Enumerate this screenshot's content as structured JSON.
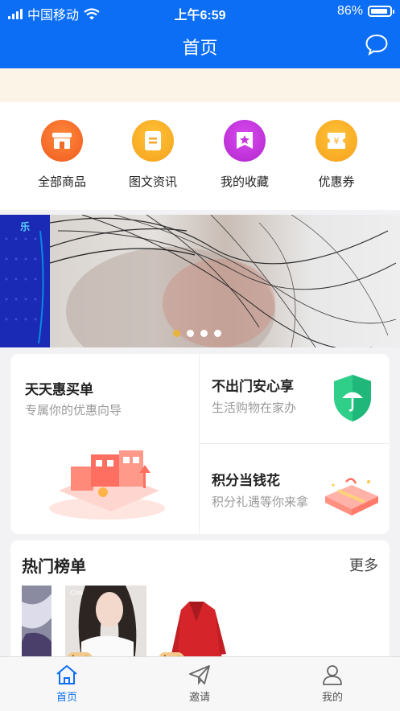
{
  "status_bar": {
    "carrier": "中国移动",
    "time": "上午6:59",
    "battery": "86%"
  },
  "nav": {
    "title": "首页",
    "chat_icon": "chat-bubble-icon"
  },
  "quick_links": [
    {
      "label": "全部商品",
      "icon": "storefront-icon",
      "color": "#f26b2a"
    },
    {
      "label": "图文资讯",
      "icon": "document-icon",
      "color": "#f5a623"
    },
    {
      "label": "我的收藏",
      "icon": "favorite-ribbon-icon",
      "color": "#c43ad9"
    },
    {
      "label": "优惠券",
      "icon": "coupon-icon",
      "color": "#f5a623"
    }
  ],
  "banner": {
    "left_glyph": "乐",
    "slide_count": 4,
    "active_slide": 1
  },
  "promo": {
    "left": {
      "title": "天天惠买单",
      "subtitle": "专属你的优惠向导"
    },
    "right_top": {
      "title": "不出门安心享",
      "subtitle": "生活购物在家办"
    },
    "right_bottom": {
      "title": "积分当钱花",
      "subtitle": "积分礼遇等你来拿"
    }
  },
  "hot": {
    "title": "热门榜单",
    "more": "更多",
    "tag": "hot",
    "thumb_caption": "Cmi"
  },
  "tabbar": [
    {
      "label": "首页",
      "icon": "home-icon",
      "active": true
    },
    {
      "label": "邀请",
      "icon": "paper-plane-icon",
      "active": false
    },
    {
      "label": "我的",
      "icon": "user-icon",
      "active": false
    }
  ],
  "colors": {
    "primary": "#0b6ef5",
    "notice_bg": "#fdf4e8",
    "active_dot": "#e8b339"
  }
}
